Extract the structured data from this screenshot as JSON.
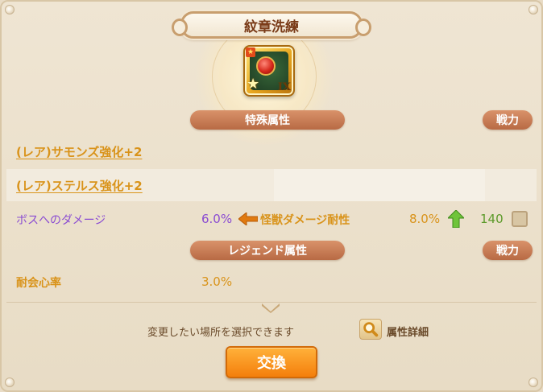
{
  "title": "紋章洗練",
  "emblem": {
    "rank": "IX"
  },
  "special_section": {
    "header": "特殊属性",
    "power_button": "戦力",
    "attributes": [
      {
        "label": "(レア)サモンズ強化+2"
      },
      {
        "label": "(レア)ステルス強化+2"
      }
    ],
    "damage_row": {
      "current_label": "ボスへのダメージ",
      "current_value": "6.0%",
      "new_label": "怪獣ダメージ耐性",
      "new_value": "8.0%",
      "power": "140"
    }
  },
  "legend_section": {
    "header": "レジェンド属性",
    "power_button": "戦力",
    "attribute_label": "耐会心率",
    "attribute_value": "3.0%"
  },
  "footer": {
    "hint": "変更したい場所を選択できます",
    "details_label": "属性詳細",
    "exchange_button": "交換"
  },
  "colors": {
    "accent_orange": "#f47f0c",
    "pill_brown": "#b86a44",
    "value_orange": "#d9931a",
    "purple_text": "#8a4bd2",
    "green_text": "#5c9a2a"
  },
  "icons": [
    "emblem-icon",
    "arrow-left-icon",
    "arrow-up-icon",
    "chevron-down-icon",
    "magnifier-icon"
  ]
}
